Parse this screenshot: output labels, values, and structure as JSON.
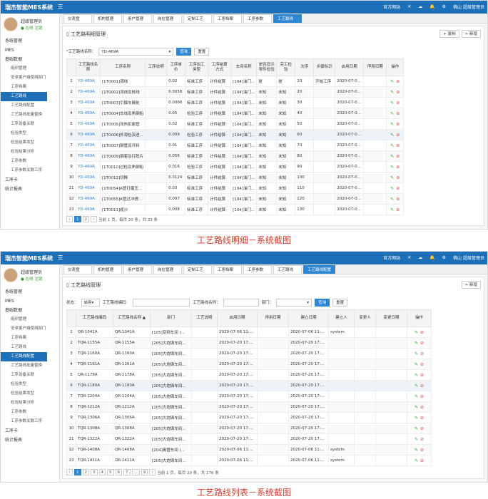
{
  "app": {
    "brand": "瑞杰智能MES系统",
    "right": [
      "官方网站",
      "佛山",
      "超级管理员"
    ],
    "user": {
      "name": "超级管理员",
      "status_online": "● 在线",
      "status_logout": "注销"
    }
  },
  "nav": [
    {
      "label": "系统管理",
      "level": 0
    },
    {
      "label": "MES",
      "level": 0
    },
    {
      "label": "基础数据",
      "level": 0
    },
    {
      "label": "组织管理",
      "level": 1
    },
    {
      "label": "安卓客户端使用部门",
      "level": 1
    },
    {
      "label": "工序档案",
      "level": 1
    },
    {
      "label": "工艺路线",
      "level": 1
    },
    {
      "label": "工艺路线配置",
      "level": 1
    },
    {
      "label": "工艺路线批量替换",
      "level": 1
    },
    {
      "label": "工序设备关联",
      "level": 1
    },
    {
      "label": "检验类型",
      "level": 1
    },
    {
      "label": "检验结果类型",
      "level": 1
    },
    {
      "label": "检验结果分析",
      "level": 1
    },
    {
      "label": "工序参数",
      "level": 1
    },
    {
      "label": "工序参数关联工序",
      "level": 1
    },
    {
      "label": "工序卡",
      "level": 0
    },
    {
      "label": "统计报表",
      "level": 0
    }
  ],
  "tabs": [
    "仪表盘",
    "机构管理",
    "用户管理",
    "岗位管理",
    "定制工艺",
    "工序档案",
    "工序参数",
    "工艺路线",
    "工艺路线配置"
  ],
  "shot1": {
    "active_tab": "工艺路线",
    "active_nav": "工艺路线",
    "title": "工艺路明细管理",
    "buttons": {
      "copy": "+ 复制",
      "add": "+ 新增"
    },
    "filter": {
      "label": "*工艺路线名称：",
      "value": "YD-469A",
      "search": "查询",
      "reset": "重置"
    },
    "columns": [
      "",
      "工艺路线名称",
      "工序名称",
      "工序说明",
      "工序单价",
      "工序加工类型",
      "工序结算方式",
      "车间名称",
      "是否显示零件检验",
      "完工检验",
      "次序",
      "步骤标识",
      "启用日期",
      "停用日期",
      "操作"
    ],
    "rows": [
      [
        "1",
        "YD-469A",
        "[1T0001]调线",
        "",
        "0.02",
        "标准工序",
        "计件结算",
        "[104]油门...",
        "是",
        "是",
        "10",
        "开始工序",
        "2020-07-0...",
        ""
      ],
      [
        "2",
        "YD-469A",
        "[1T0002]流线及核线",
        "",
        "0.0058",
        "标准工序",
        "计件结算",
        "[104]油门...",
        "未知",
        "未知",
        "20",
        "",
        "2020-07-0...",
        ""
      ],
      [
        "3",
        "YD-469A",
        "[1T0003]引爆车厢处",
        "",
        "0.0066",
        "标准工序",
        "计件结算",
        "[104]油门...",
        "未知",
        "未知",
        "30",
        "",
        "2020-07-0...",
        ""
      ],
      [
        "4",
        "YD-469A",
        "[1T0004]车线及角钢船",
        "",
        "0.05",
        "检验工序",
        "计件结算",
        "[104]油门...",
        "未知",
        "未知",
        "40",
        "",
        "2020-07-0...",
        ""
      ],
      [
        "5",
        "YD-469A",
        "[1T0005]攻热扣座管",
        "",
        "0.02",
        "标准工序",
        "计件结算",
        "[104]油门...",
        "未知",
        "未知",
        "50",
        "",
        "2020-07-0...",
        ""
      ],
      [
        "6",
        "YD-469A",
        "[1T0006]外观检及进...",
        "",
        "0.009",
        "检验工序",
        "计件结算",
        "[104]油门...",
        "未知",
        "未知",
        "60",
        "",
        "2020-07-0...",
        ""
      ],
      [
        "7",
        "YD-469A",
        "[1T0007]钢管及开料",
        "",
        "0.01",
        "标准工序",
        "计件结算",
        "[104]油门...",
        "未知",
        "未知",
        "70",
        "",
        "2020-07-0...",
        ""
      ],
      [
        "8",
        "YD-469A",
        "[1T0009]钢套及打胶片",
        "",
        "0.056",
        "标准工序",
        "计件结算",
        "[104]油门...",
        "未知",
        "未知",
        "80",
        "",
        "2020-07-0...",
        ""
      ],
      [
        "9",
        "YD-469A",
        "[1T0010]过检及角钢船",
        "",
        "0.016",
        "检验工序",
        "计件结算",
        "[104]油门...",
        "未知",
        "未知",
        "90",
        "",
        "2020-07-0...",
        ""
      ],
      [
        "10",
        "YD-469A",
        "[1T0012]切棒",
        "",
        "0.0124",
        "标准工序",
        "计件结算",
        "[104]油门...",
        "未知",
        "未知",
        "100",
        "",
        "2020-07-0...",
        ""
      ],
      [
        "11",
        "YD-469A",
        "[1T0054]A管打磨压...",
        "",
        "0.03",
        "标准工序",
        "计件结算",
        "[104]油门...",
        "未知",
        "未知",
        "110",
        "",
        "2020-07-0...",
        ""
      ],
      [
        "12",
        "YD-469A",
        "[1T0055]A管过冲焊...",
        "",
        "0.007",
        "标准工序",
        "计件结算",
        "[104]油门...",
        "未知",
        "未知",
        "120",
        "",
        "2020-07-0...",
        ""
      ],
      [
        "13",
        "YD-469A",
        "[1T0011]缆沙",
        "",
        "0.008",
        "标准工序",
        "计件结算",
        "[104]油门...",
        "未知",
        "未知",
        "130",
        "",
        "2020-07-0...",
        ""
      ]
    ],
    "pager": {
      "pages": [
        "1",
        "2"
      ],
      "info": "当前 1 页，每页 20 条，共 33 条"
    },
    "caption": "工艺路线明细－系统截图"
  },
  "shot2": {
    "active_tab": "工艺路线配置",
    "active_nav": "工艺路线配置",
    "title": "工艺路线管理",
    "buttons": {
      "add": "+ 新增"
    },
    "filter": {
      "status_label": "状态：",
      "status_value": "启用",
      "code_label": "工艺路线编码：",
      "name_label": "工艺路线名称：",
      "dept_label": "部门：",
      "search": "查询",
      "reset": "重置"
    },
    "columns": [
      "",
      "工艺路线编码",
      "工艺路线名称 ▲",
      "部门",
      "工艺说明",
      "启用日期",
      "停用日期",
      "建立日期",
      "建立人",
      "变更人",
      "变更日期",
      "操作"
    ],
    "rows": [
      [
        "1",
        "QR-1041A",
        "QR-1041A",
        "[105]变频车间 (...",
        "",
        "2020-07-06 11:...",
        "",
        "2020-07-06 11:...",
        "system",
        "",
        ""
      ],
      [
        "2",
        "TQR-1155A",
        "QR-1155A",
        "[205]大炮铸车间...",
        "",
        "2020-07-20 17:...",
        "",
        "2020-07-20 17:...",
        "",
        "",
        ""
      ],
      [
        "3",
        "TQR-1160A",
        "QR-1160A",
        "[205]大炮铸车间...",
        "",
        "2020-07-20 17:...",
        "",
        "2020-07-20 17:...",
        "",
        "",
        ""
      ],
      [
        "4",
        "TQR-1161A",
        "QR-1161A",
        "[205]大炮铸车间...",
        "",
        "2020-07-20 17:...",
        "",
        "2020-07-20 17:...",
        "",
        "",
        ""
      ],
      [
        "5",
        "QR-1178A",
        "QR-1178A",
        "[205]大炮铸车间...",
        "",
        "2020-07-20 17:...",
        "",
        "2020-07-20 17:...",
        "",
        "",
        ""
      ],
      [
        "6",
        "TQR-1180A",
        "QR-1180A",
        "[205]大炮铸车间...",
        "",
        "2020-07-20 17:...",
        "",
        "2020-07-20 17:...",
        "",
        "",
        ""
      ],
      [
        "7",
        "TQR-1204A",
        "QR-1204A",
        "[205]大炮铸车间...",
        "",
        "2020-07-20 17:...",
        "",
        "2020-07-20 17:...",
        "",
        "",
        ""
      ],
      [
        "8",
        "TQR-1212A",
        "QR-1212A",
        "[205]大炮铸车间...",
        "",
        "2020-07-20 17:...",
        "",
        "2020-07-20 17:...",
        "",
        "",
        ""
      ],
      [
        "9",
        "TQR-1306A",
        "QR-1306A",
        "[205]大炮铸车间...",
        "",
        "2020-07-20 17:...",
        "",
        "2020-07-20 17:...",
        "",
        "",
        ""
      ],
      [
        "10",
        "TQR-1308A",
        "QR-1308A",
        "[205]大炮铸车间...",
        "",
        "2020-07-20 17:...",
        "",
        "2020-07-20 17:...",
        "",
        "",
        ""
      ],
      [
        "11",
        "TQR-1322A",
        "QR-1322A",
        "[205]大炮铸车间...",
        "",
        "2020-07-20 17:...",
        "",
        "2020-07-20 17:...",
        "",
        "",
        ""
      ],
      [
        "12",
        "TQR-1408A",
        "QR-1408A",
        "[204]离管车间 (...",
        "",
        "2020-07-06 11:...",
        "",
        "2020-07-06 11:...",
        "system",
        "",
        ""
      ],
      [
        "13",
        "TQR-1411A",
        "QR-1411A",
        "[205]大炮铸车间...",
        "",
        "2020-07-06 11:...",
        "",
        "2020-07-06 11:...",
        "system",
        "",
        ""
      ]
    ],
    "pager": {
      "pages": [
        "1",
        "2",
        "3",
        "4",
        "5",
        "6",
        "7",
        "...",
        "9"
      ],
      "info": "当前 1 页，每页 20 条，共 176 条"
    },
    "caption": "工艺路线列表－系统截图"
  }
}
